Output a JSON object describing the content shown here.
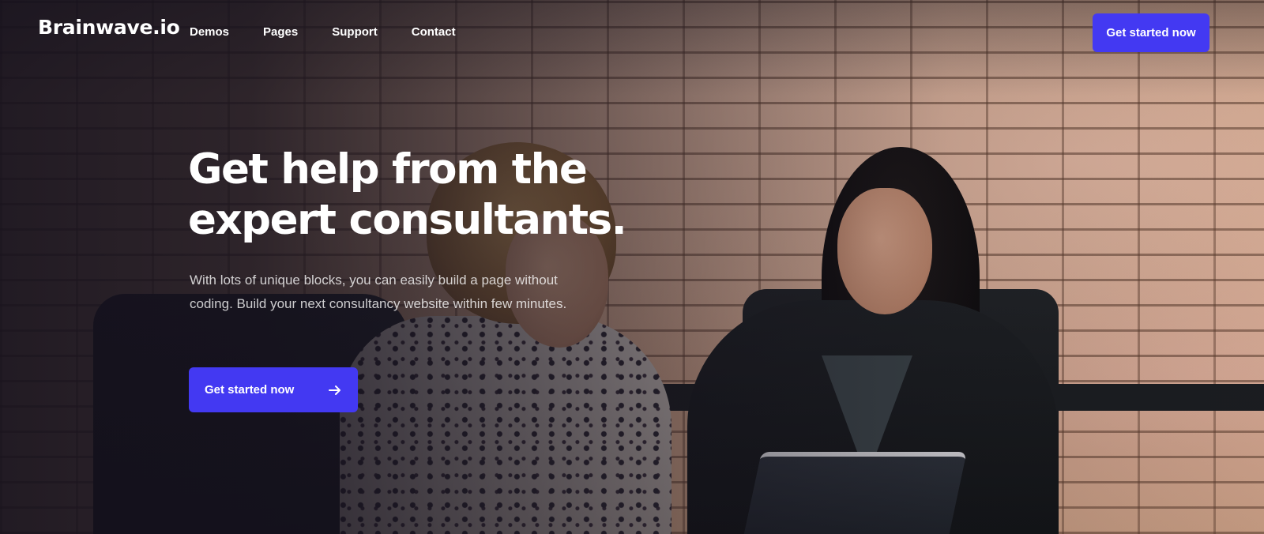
{
  "brand": {
    "logo_text": "Brainwave.io",
    "accent_color": "#4339f2"
  },
  "nav": {
    "links": [
      "Demos",
      "Pages",
      "Support",
      "Contact"
    ],
    "cta_label": "Get started now"
  },
  "hero": {
    "title_line_1": "Get help from the",
    "title_line_2": "expert consultants.",
    "subtitle": "With lots of unique blocks, you can easily build a page without coding. Build your next consultancy website within few minutes.",
    "cta_label": "Get started now",
    "cta_icon": "arrow-right-icon"
  }
}
